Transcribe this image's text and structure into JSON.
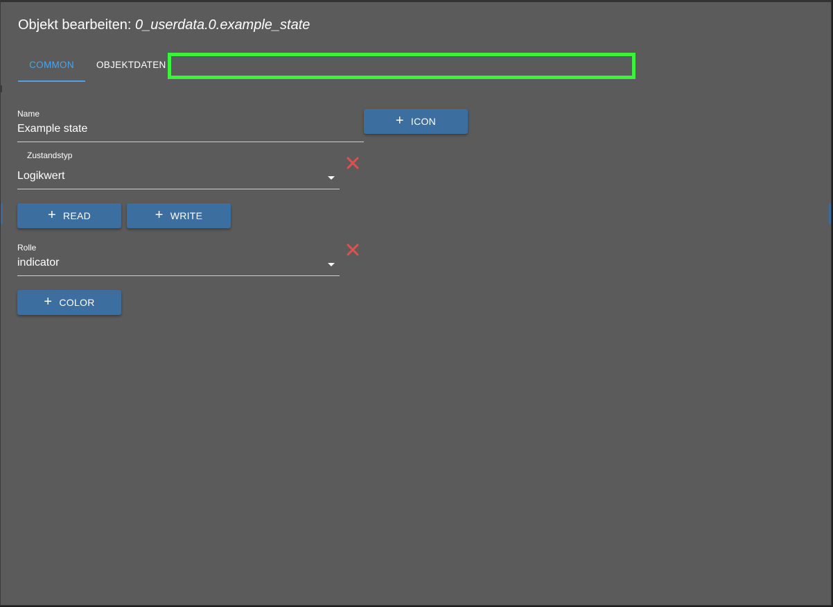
{
  "dialog": {
    "title_prefix": "Objekt bearbeiten:",
    "title_path": "0_userdata.0.example_state"
  },
  "tabs": [
    {
      "label": "COMMON",
      "active": true
    },
    {
      "label": "OBJEKTDATEN",
      "active": false
    }
  ],
  "fields": {
    "name": {
      "label": "Name",
      "value": "Example state"
    },
    "state_type": {
      "label": "Zustandstyp",
      "value": "Logikwert"
    },
    "role": {
      "label": "Rolle",
      "value": "indicator"
    }
  },
  "buttons": {
    "icon": "ICON",
    "read": "READ",
    "write": "WRITE",
    "color": "COLOR",
    "plus_glyph": "+"
  },
  "colors": {
    "background": "#5b5b5b",
    "accent": "#4da3ea",
    "button": "#3d6ea0",
    "clear": "#e05050",
    "highlight": "#3bf33b"
  },
  "icons": {
    "clear": "close-x-icon",
    "dropdown": "caret-down-icon",
    "add": "plus-icon"
  }
}
